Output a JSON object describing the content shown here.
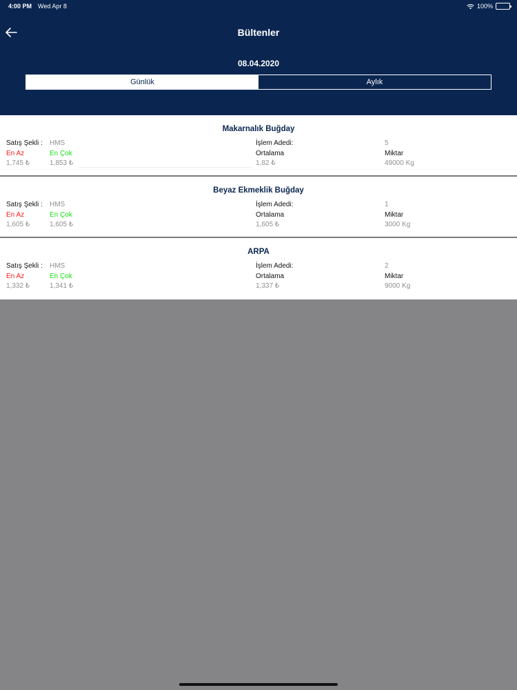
{
  "status_bar": {
    "time": "4:00 PM",
    "date": "Wed Apr 8",
    "battery": "100%"
  },
  "header": {
    "title": "Bültenler",
    "date": "08.04.2020"
  },
  "tabs": [
    {
      "label": "Günlük",
      "active": true
    },
    {
      "label": "Aylık",
      "active": false
    }
  ],
  "labels": {
    "sale_type": "Satış Şekli :",
    "min": "En Az",
    "max": "En Çok",
    "trade_count": "İşlem Adedi:",
    "average": "Ortalama",
    "amount": "Miktar"
  },
  "items": [
    {
      "title": "Makarnalık Buğday",
      "sale_type": "HMS",
      "trade_count": "5",
      "min": "1,745 ₺",
      "max": "1,853 ₺",
      "average": "1,82 ₺",
      "amount": "49000 Kg"
    },
    {
      "title": "Beyaz Ekmeklik Buğday",
      "sale_type": "HMS",
      "trade_count": "1",
      "min": "1,605 ₺",
      "max": "1,605 ₺",
      "average": "1,605 ₺",
      "amount": "3000 Kg"
    },
    {
      "title": "ARPA",
      "sale_type": "HMS",
      "trade_count": "2",
      "min": "1,332 ₺",
      "max": "1,341 ₺",
      "average": "1,337 ₺",
      "amount": "9000 Kg"
    }
  ],
  "colors": {
    "header_bg": "#0a2650",
    "min_label": "#ff1a1a",
    "max_label": "#16dd16",
    "empty_bg": "#858486"
  }
}
